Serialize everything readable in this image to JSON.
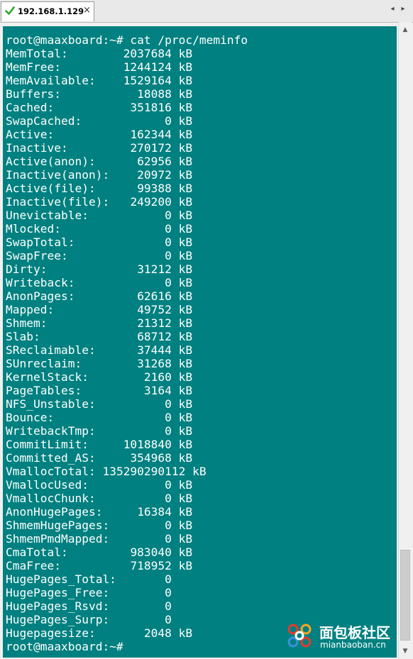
{
  "tab": {
    "title": "192.168.1.129",
    "status_icon": "check-icon",
    "close_label": "×"
  },
  "nav": {
    "left_label": "◂",
    "right_label": "▸"
  },
  "scrollbar": {
    "up_label": "▲",
    "down_label": "▼"
  },
  "terminal": {
    "prompt_command": "root@maaxboard:~# cat /proc/meminfo",
    "meminfo": [
      {
        "key": "MemTotal:",
        "value": "2037684",
        "unit": "kB"
      },
      {
        "key": "MemFree:",
        "value": "1244124",
        "unit": "kB"
      },
      {
        "key": "MemAvailable:",
        "value": "1529164",
        "unit": "kB"
      },
      {
        "key": "Buffers:",
        "value": "18088",
        "unit": "kB"
      },
      {
        "key": "Cached:",
        "value": "351816",
        "unit": "kB"
      },
      {
        "key": "SwapCached:",
        "value": "0",
        "unit": "kB"
      },
      {
        "key": "Active:",
        "value": "162344",
        "unit": "kB"
      },
      {
        "key": "Inactive:",
        "value": "270172",
        "unit": "kB"
      },
      {
        "key": "Active(anon):",
        "value": "62956",
        "unit": "kB"
      },
      {
        "key": "Inactive(anon):",
        "value": "20972",
        "unit": "kB"
      },
      {
        "key": "Active(file):",
        "value": "99388",
        "unit": "kB"
      },
      {
        "key": "Inactive(file):",
        "value": "249200",
        "unit": "kB"
      },
      {
        "key": "Unevictable:",
        "value": "0",
        "unit": "kB"
      },
      {
        "key": "Mlocked:",
        "value": "0",
        "unit": "kB"
      },
      {
        "key": "SwapTotal:",
        "value": "0",
        "unit": "kB"
      },
      {
        "key": "SwapFree:",
        "value": "0",
        "unit": "kB"
      },
      {
        "key": "Dirty:",
        "value": "31212",
        "unit": "kB"
      },
      {
        "key": "Writeback:",
        "value": "0",
        "unit": "kB"
      },
      {
        "key": "AnonPages:",
        "value": "62616",
        "unit": "kB"
      },
      {
        "key": "Mapped:",
        "value": "49752",
        "unit": "kB"
      },
      {
        "key": "Shmem:",
        "value": "21312",
        "unit": "kB"
      },
      {
        "key": "Slab:",
        "value": "68712",
        "unit": "kB"
      },
      {
        "key": "SReclaimable:",
        "value": "37444",
        "unit": "kB"
      },
      {
        "key": "SUnreclaim:",
        "value": "31268",
        "unit": "kB"
      },
      {
        "key": "KernelStack:",
        "value": "2160",
        "unit": "kB"
      },
      {
        "key": "PageTables:",
        "value": "3164",
        "unit": "kB"
      },
      {
        "key": "NFS_Unstable:",
        "value": "0",
        "unit": "kB"
      },
      {
        "key": "Bounce:",
        "value": "0",
        "unit": "kB"
      },
      {
        "key": "WritebackTmp:",
        "value": "0",
        "unit": "kB"
      },
      {
        "key": "CommitLimit:",
        "value": "1018840",
        "unit": "kB"
      },
      {
        "key": "Committed_AS:",
        "value": "354968",
        "unit": "kB"
      },
      {
        "key": "VmallocTotal:",
        "value": "135290290112",
        "unit": "kB"
      },
      {
        "key": "VmallocUsed:",
        "value": "0",
        "unit": "kB"
      },
      {
        "key": "VmallocChunk:",
        "value": "0",
        "unit": "kB"
      },
      {
        "key": "AnonHugePages:",
        "value": "16384",
        "unit": "kB"
      },
      {
        "key": "ShmemHugePages:",
        "value": "0",
        "unit": "kB"
      },
      {
        "key": "ShmemPmdMapped:",
        "value": "0",
        "unit": "kB"
      },
      {
        "key": "CmaTotal:",
        "value": "983040",
        "unit": "kB"
      },
      {
        "key": "CmaFree:",
        "value": "718952",
        "unit": "kB"
      },
      {
        "key": "HugePages_Total:",
        "value": "0",
        "unit": ""
      },
      {
        "key": "HugePages_Free:",
        "value": "0",
        "unit": ""
      },
      {
        "key": "HugePages_Rsvd:",
        "value": "0",
        "unit": ""
      },
      {
        "key": "HugePages_Surp:",
        "value": "0",
        "unit": ""
      },
      {
        "key": "Hugepagesize:",
        "value": "2048",
        "unit": "kB"
      }
    ],
    "final_prompt": "root@maaxboard:~#"
  },
  "watermark": {
    "title": "面包板社区",
    "subtitle": "mianbaoban.cn"
  },
  "colors": {
    "terminal_background": "#008080",
    "terminal_text": "#ffffff",
    "status_check": "#2aa52a"
  }
}
